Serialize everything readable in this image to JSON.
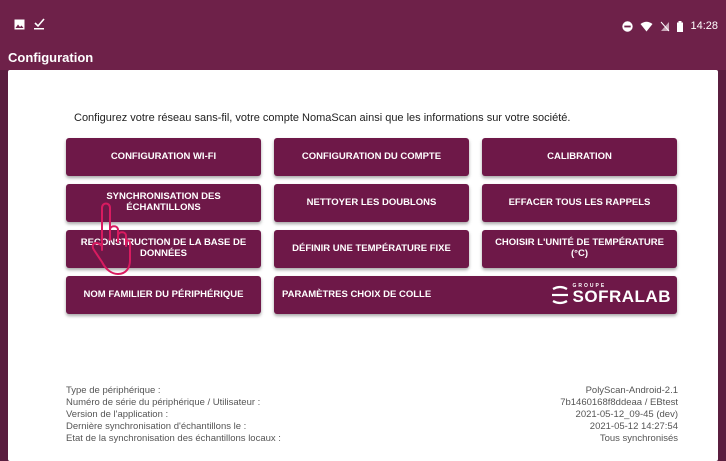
{
  "status_bar": {
    "time": "14:28",
    "left_icons": [
      "image-icon",
      "check-download-icon"
    ],
    "right_icons": [
      "do-not-disturb-icon",
      "wifi-icon",
      "no-sim-icon",
      "battery-icon"
    ]
  },
  "app_bar": {
    "title": "Configuration"
  },
  "intro_text": "Configurez votre réseau sans-fil, votre compte NomaScan ainsi que les informations sur votre société.",
  "buttons": [
    {
      "label": "Configuration Wi-Fi"
    },
    {
      "label": "Configuration du compte"
    },
    {
      "label": "Calibration"
    },
    {
      "label": "Synchronisation des échantillons"
    },
    {
      "label": "Nettoyer les doublons"
    },
    {
      "label": "Effacer tous les rappels"
    },
    {
      "label": "Reconstruction de la base de données"
    },
    {
      "label": "Définir une température fixe"
    },
    {
      "label": "Choisir l'unité de température (°C)"
    },
    {
      "label": "Nom familier du périphérique"
    },
    {
      "label": "Paramètres choix de colle"
    }
  ],
  "logo": {
    "small": "GROUPE",
    "text": "SOFRALAB"
  },
  "info": {
    "labels": [
      "Type de périphérique :",
      "Numéro de série du périphérique / Utilisateur :",
      "Version de l'application :",
      "Dernière synchronisation d'échantillons le :",
      "Etat de la synchronisation des échantillons locaux :"
    ],
    "values": [
      "PolyScan-Android-2.1",
      "7b1460168f8ddeaa / EBtest",
      "2021-05-12_09-45 (dev)",
      "2021-05-12 14:27:54",
      "Tous synchronisés"
    ]
  },
  "colors": {
    "primary": "#6e2149",
    "button": "#6e1848",
    "background": "#ffffff"
  }
}
